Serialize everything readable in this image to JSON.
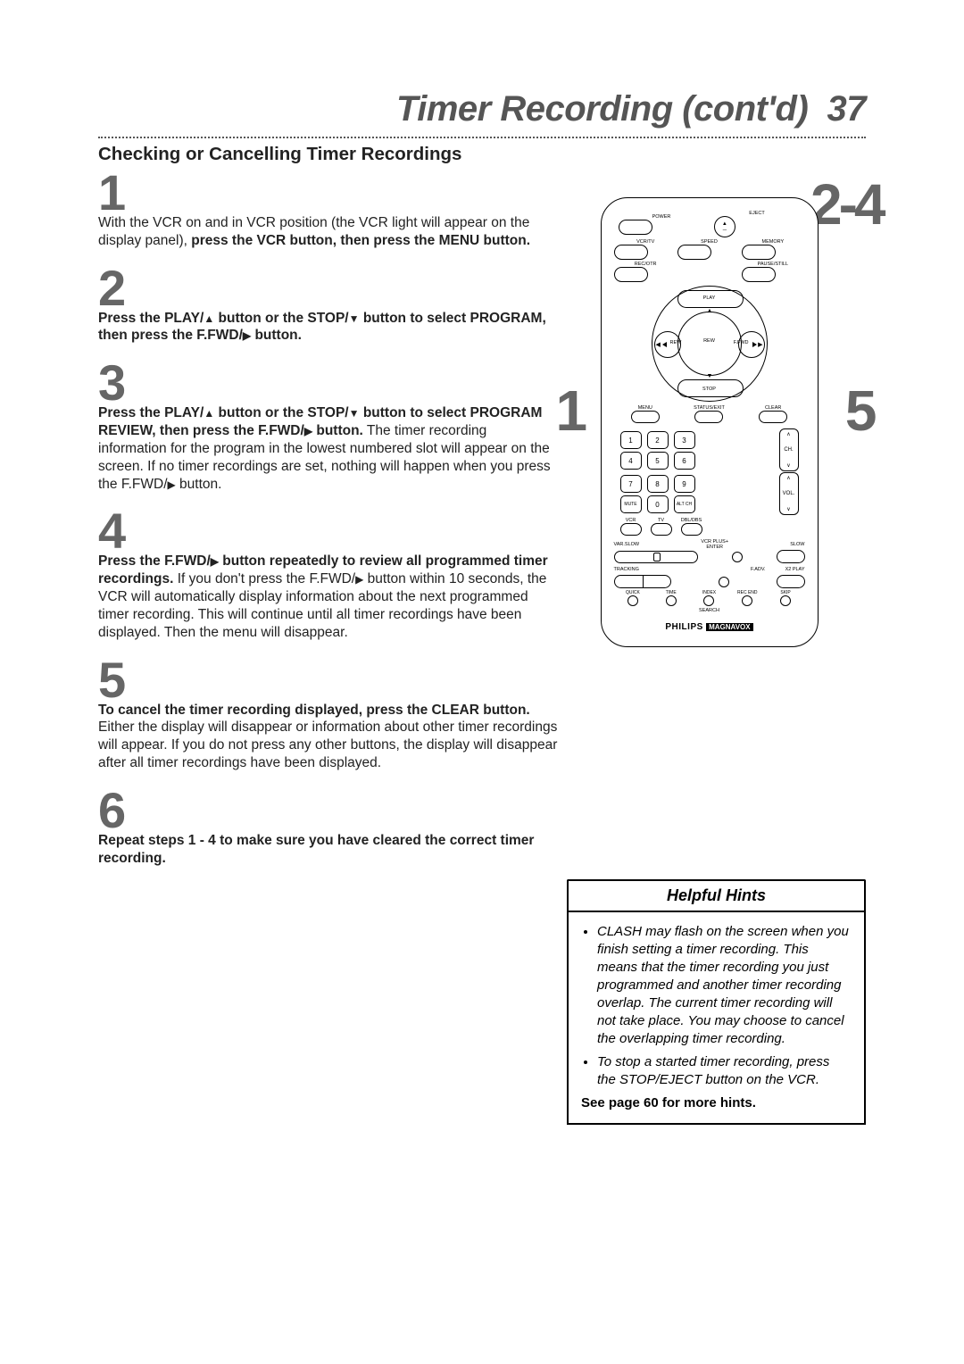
{
  "page_title_prefix": "Timer Recording (cont'd)",
  "page_number": "37",
  "subtitle": "Checking or Cancelling Timer Recordings",
  "callouts": {
    "top_right": "2-4",
    "left": "1",
    "right": "5"
  },
  "steps": [
    {
      "num": "1",
      "plain_before": "With the VCR on and in VCR position (the VCR light will appear on the display panel), ",
      "bold": "press the VCR button, then press the MENU button.",
      "plain_after": ""
    },
    {
      "num": "2",
      "bold_a": "Press the PLAY/",
      "glyph_a": "▲",
      "bold_b": " button or the STOP/",
      "glyph_b": "▼",
      "bold_c": " button to select PROGRAM, then press the F.FWD/",
      "glyph_c": "▶",
      "bold_d": " button."
    },
    {
      "num": "3",
      "bold_a": "Press the PLAY/",
      "glyph_a": "▲",
      "bold_b": " button or the STOP/",
      "glyph_b": "▼",
      "bold_c": " button to select PROGRAM REVIEW, then press the F.FWD/",
      "glyph_c": "▶",
      "bold_d": " button.",
      "plain": " The timer recording information for the program in the lowest numbered slot will appear on the screen. If no timer recordings are set, nothing will happen when you press the F.FWD/",
      "glyph_end": "▶",
      "plain_end": " button."
    },
    {
      "num": "4",
      "bold_a": "Press the F.FWD/",
      "glyph_a": "▶",
      "bold_b": " button repeatedly to review all programmed timer recordings.",
      "plain": " If you don't press the F.FWD/",
      "glyph_mid": "▶",
      "plain2": " button within 10 seconds, the VCR will automatically display information about the next programmed timer recording. This will continue until all timer recordings have been displayed. Then the menu will disappear."
    },
    {
      "num": "5",
      "bold_a": "To cancel the timer recording displayed, press the CLEAR button.",
      "plain": " Either the display will disappear or information about other timer recordings will appear. If you do not press any other buttons, the display will disappear after all timer recordings have been displayed."
    },
    {
      "num": "6",
      "bold_a": "Repeat steps 1 - 4 to make sure you have cleared the correct timer recording."
    }
  ],
  "remote": {
    "row1": {
      "left": "POWER",
      "right": "EJECT"
    },
    "row2": {
      "a": "VCR/TV",
      "b": "SPEED",
      "c": "MEMORY"
    },
    "row3": {
      "a": "REC/OTR",
      "c": "PAUSE/STILL"
    },
    "play_block": {
      "play": "PLAY",
      "stop": "STOP",
      "rew": "REW",
      "ffwd": "F.FWD"
    },
    "menu_row": {
      "a": "MENU",
      "b": "STATUS/EXIT",
      "c": "CLEAR"
    },
    "keypad": [
      "1",
      "2",
      "3",
      "4",
      "5",
      "6",
      "7",
      "8",
      "9",
      "MUTE",
      "0",
      "ALT CH"
    ],
    "ch": "CH.",
    "vol": "VOL.",
    "vcr_tv_dbl": {
      "a": "VCR",
      "b": "TV",
      "c": "DBL/DBS"
    },
    "slow": {
      "left": "VAR.SLOW",
      "mid": "VCR PLUS+ ENTER",
      "right": "SLOW"
    },
    "tracking": {
      "a": "TRACKING",
      "b": "F.ADV.",
      "c": "X2 PLAY"
    },
    "search": [
      "QUICK",
      "TIME",
      "INDEX",
      "REC END",
      "SKIP"
    ],
    "search_label": "SEARCH",
    "brand_a": "PHILIPS",
    "brand_b": "MAGNAVOX"
  },
  "hints": {
    "title": "Helpful Hints",
    "items": [
      "CLASH may flash on the screen when you finish setting a timer recording. This means that the timer recording you just programmed and another timer recording overlap. The current timer recording will not take place. You may choose to cancel the overlapping timer recording.",
      "To stop a started timer recording, press the STOP/EJECT button on the VCR."
    ],
    "footer": "See page 60 for more hints."
  }
}
